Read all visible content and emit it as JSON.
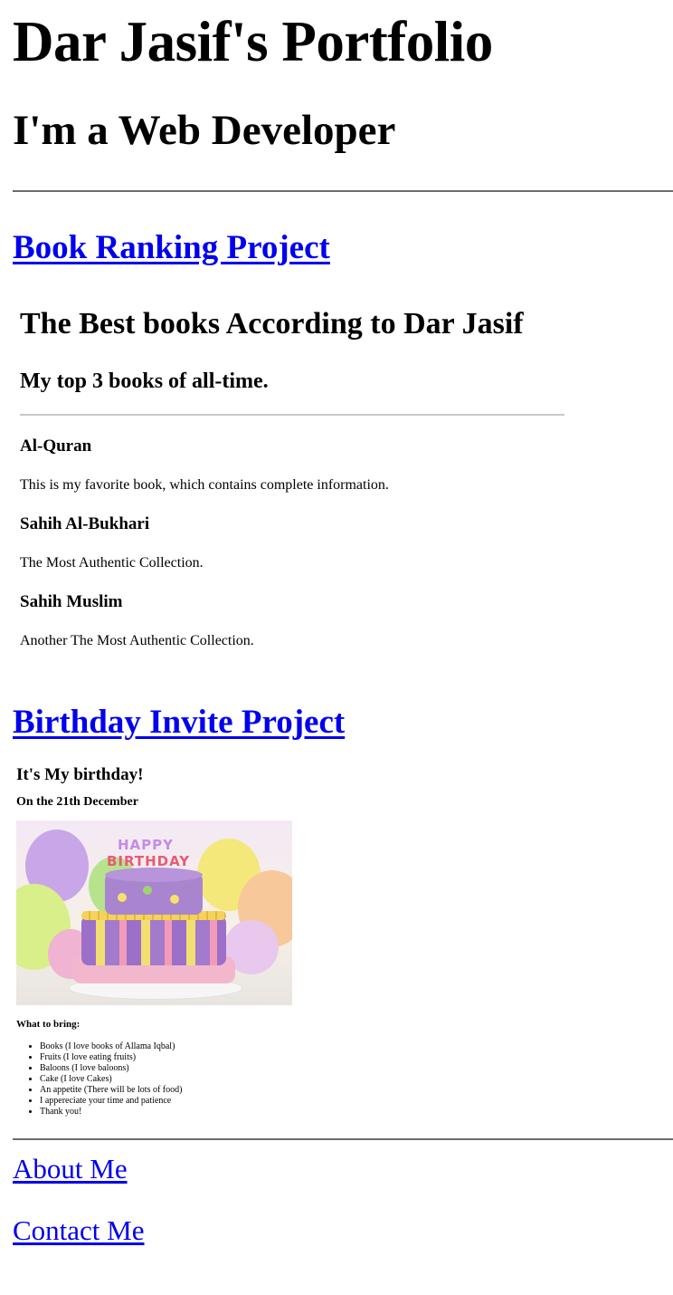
{
  "header": {
    "title": "Dar Jasif's Portfolio",
    "subtitle": "I'm a Web Developer"
  },
  "book_project": {
    "link_label": "Book Ranking Project",
    "title": "The Best books According to Dar Jasif",
    "subtitle": "My top 3 books of all-time.",
    "books": [
      {
        "name": "Al-Quran",
        "description": "This is my favorite book, which contains complete information."
      },
      {
        "name": "Sahih Al-Bukhari",
        "description": "The Most Authentic Collection."
      },
      {
        "name": "Sahih Muslim",
        "description": "Another The Most Authentic Collection."
      }
    ]
  },
  "birthday_project": {
    "link_label": "Birthday Invite Project",
    "title": "It's My birthday!",
    "date": "On the 21th December",
    "cake_text_top": "HAPPY",
    "cake_text_bottom": "BIRTHDAY",
    "bring_title": "What to bring:",
    "items": [
      "Books (I love books of Allama Iqbal)",
      "Fruits (I love eating fruits)",
      "Baloons (I love baloons)",
      "Cake (I love Cakes)",
      "An appetite (There will be lots of food)",
      "I appereciate your time and patience",
      "Thank you!"
    ]
  },
  "footer_links": {
    "about": "About Me",
    "contact": "Contact Me"
  },
  "colors": {
    "link": "#0000ee",
    "divider": "#6b6b6b"
  }
}
